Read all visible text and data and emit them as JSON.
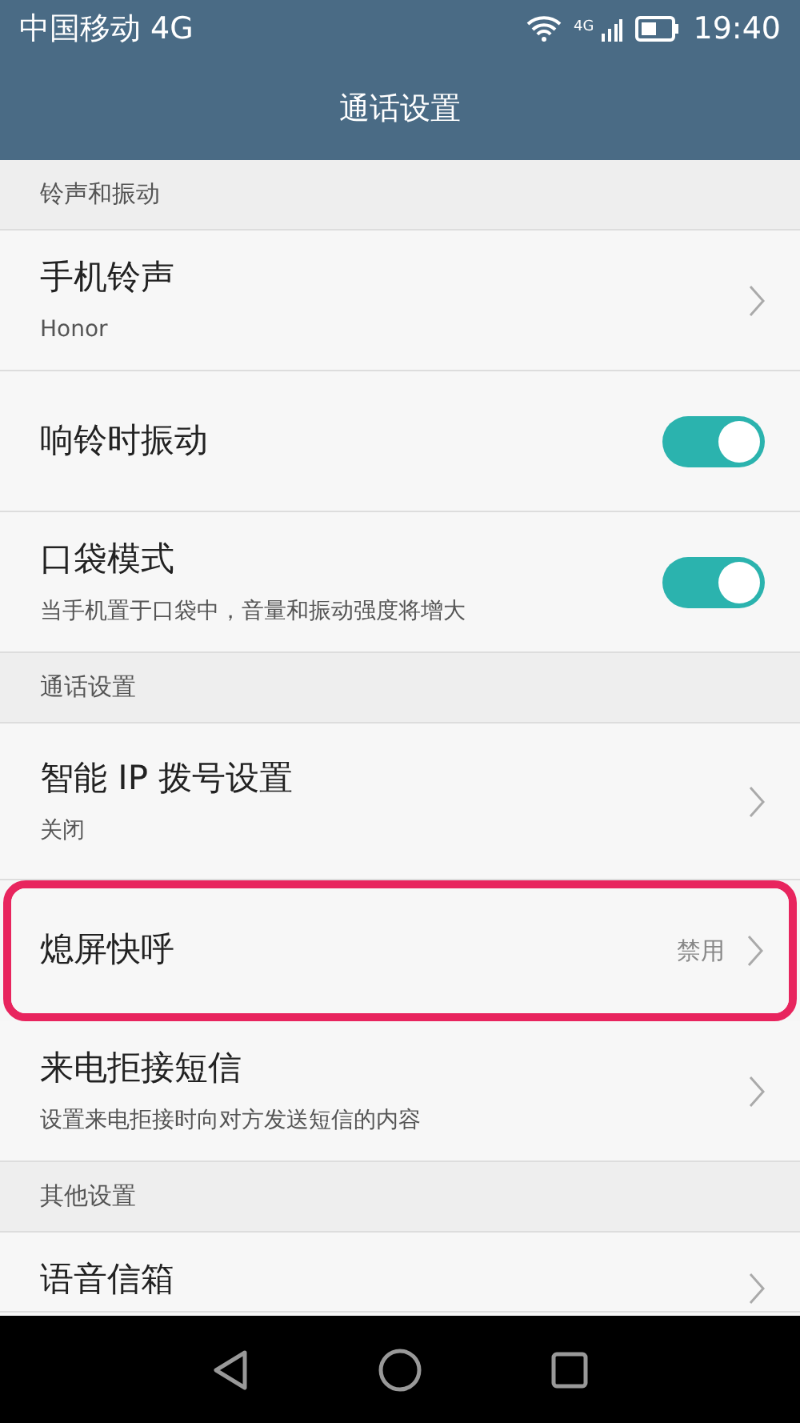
{
  "status_bar": {
    "carrier": "中国移动 4G",
    "network": "4G",
    "time": "19:40"
  },
  "title": "通话设置",
  "sections": [
    {
      "header": "铃声和振动",
      "items": [
        {
          "kind": "link",
          "label": "手机铃声",
          "subtitle": "Honor",
          "highlighted": false
        },
        {
          "kind": "toggle",
          "label": "响铃时振动",
          "on": true,
          "highlighted": false
        },
        {
          "kind": "toggle",
          "label": "口袋模式",
          "subtitle": "当手机置于口袋中，音量和振动强度将增大",
          "on": true,
          "highlighted": false
        }
      ]
    },
    {
      "header": "通话设置",
      "items": [
        {
          "kind": "link",
          "label": "智能 IP 拨号设置",
          "subtitle": "关闭",
          "highlighted": false
        },
        {
          "kind": "link",
          "label": "熄屏快呼",
          "value": "禁用",
          "highlighted": true
        },
        {
          "kind": "link",
          "label": "来电拒接短信",
          "subtitle": "设置来电拒接时向对方发送短信的内容",
          "highlighted": false
        }
      ]
    },
    {
      "header": "其他设置",
      "items": [
        {
          "kind": "link",
          "label": "语音信箱",
          "highlighted": false
        }
      ]
    }
  ]
}
